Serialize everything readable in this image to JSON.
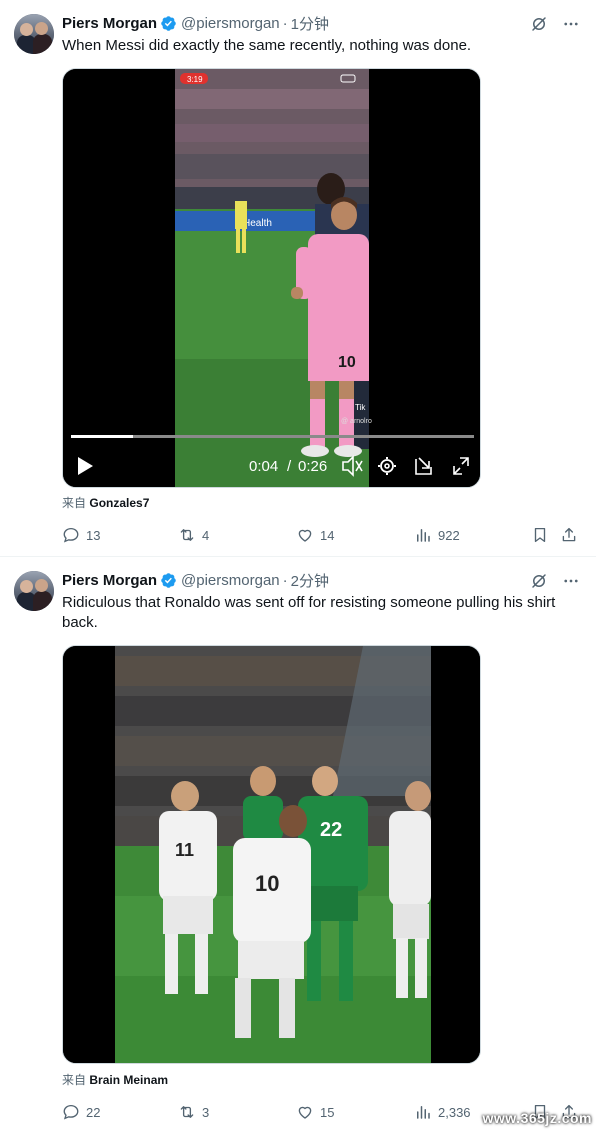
{
  "tweets": [
    {
      "name": "Piers Morgan",
      "handle": "@piersmorgan",
      "separator": "·",
      "time": "1分钟",
      "text": "When Messi did exactly the same recently, nothing was done.",
      "video": {
        "status_time": "3:19",
        "current_time": "0:04",
        "time_separator": "/",
        "duration": "0:26",
        "progress": 0.154,
        "overlay_text": "Tik",
        "overlay_handle": "@ arnolro",
        "jersey_number": "10",
        "board_text": "Health"
      },
      "via_prefix": "来自",
      "via_source": "Gonzales7",
      "stats": {
        "replies": "13",
        "reposts": "4",
        "likes": "14",
        "views": "922"
      }
    },
    {
      "name": "Piers Morgan",
      "handle": "@piersmorgan",
      "separator": "·",
      "time": "2分钟",
      "text": "Ridiculous that Ronaldo was sent off for resisting someone pulling his shirt back.",
      "video": {
        "number_a": "11",
        "number_b": "10",
        "number_c": "22"
      },
      "via_prefix": "来自",
      "via_source": "Brain Meinam",
      "stats": {
        "replies": "22",
        "reposts": "3",
        "likes": "15",
        "views": "2,336"
      }
    }
  ],
  "watermark": "www.365jz.com",
  "colors": {
    "verified": "#1d9bf0",
    "secondary_text": "#536471",
    "primary_text": "#0f1419",
    "divider": "#eff3f4",
    "jersey_pink": "#f29ac4",
    "pitch_green": "#3f8a3a",
    "ireland_green": "#1f8a43"
  }
}
